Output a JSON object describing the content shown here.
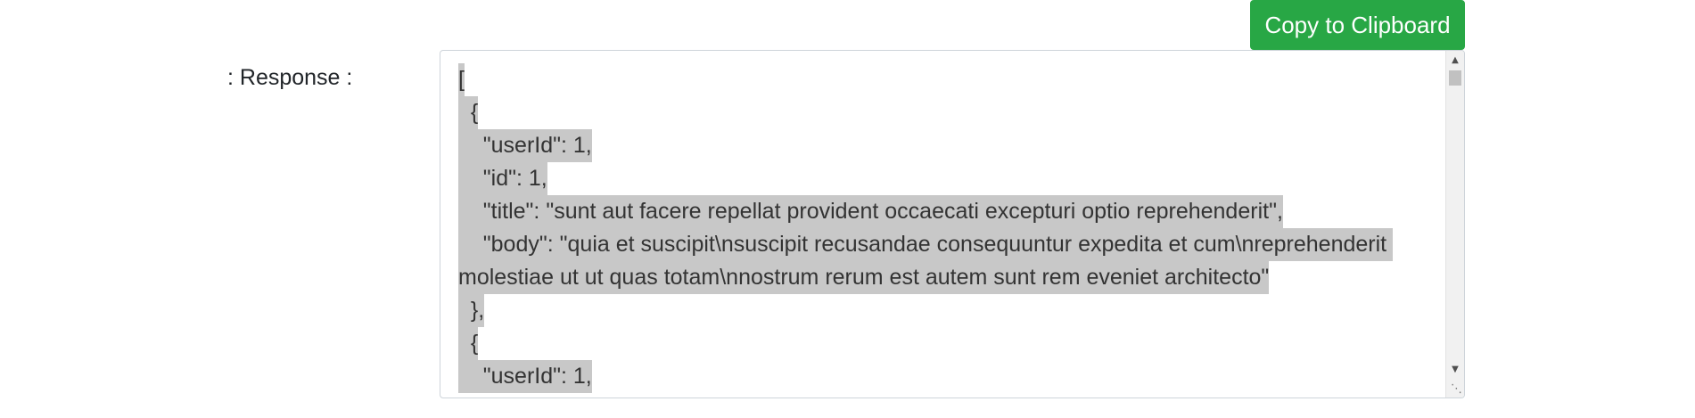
{
  "toolbar": {
    "copy_label": "Copy to Clipboard"
  },
  "response": {
    "label": ": Response :",
    "lines": [
      "[",
      "  {",
      "    \"userId\": 1,",
      "    \"id\": 1,",
      "    \"title\": \"sunt aut facere repellat provident occaecati excepturi optio reprehenderit\",",
      "    \"body\": \"quia et suscipit\\nsuscipit recusandae consequuntur expedita et cum\\nreprehenderit ",
      "molestiae ut ut quas totam\\nnostrum rerum est autem sunt rem eveniet architecto\"",
      "  },",
      "  {",
      "    \"userId\": 1,"
    ]
  },
  "icons": {
    "scroll_up": "triangle-up-icon",
    "scroll_down": "triangle-down-icon",
    "resize": "resize-grip-icon"
  },
  "colors": {
    "button_bg": "#28a745",
    "selection_bg": "#c8c8c8",
    "spell_underline": "#e02020"
  }
}
